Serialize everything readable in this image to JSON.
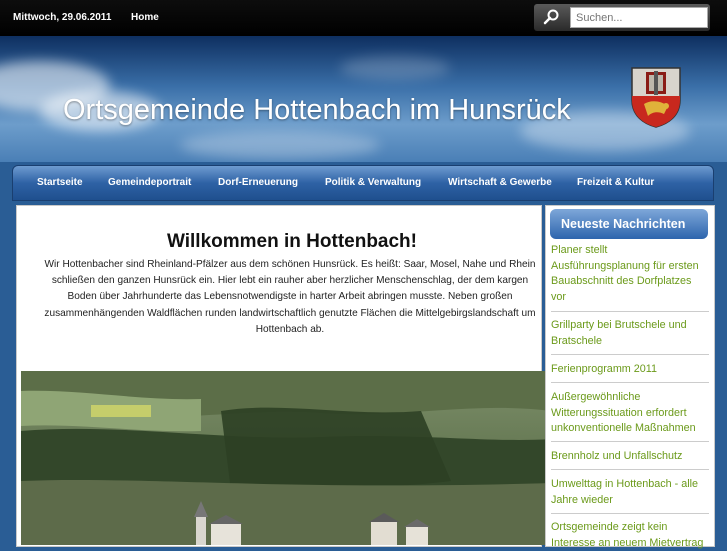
{
  "topbar": {
    "date": "Mittwoch, 29.06.2011",
    "home": "Home"
  },
  "search": {
    "placeholder": "Suchen..."
  },
  "header": {
    "title": "Ortsgemeinde Hottenbach im Hunsrück"
  },
  "nav": {
    "items": [
      {
        "label": "Startseite"
      },
      {
        "label": "Gemeindeportrait"
      },
      {
        "label": "Dorf-Erneuerung"
      },
      {
        "label": "Politik & Verwaltung"
      },
      {
        "label": "Wirtschaft & Gewerbe"
      },
      {
        "label": "Freizeit & Kultur"
      }
    ]
  },
  "main": {
    "title": "Willkommen in Hottenbach!",
    "intro_lines": [
      "Wir Hottenbacher sind Rheinland-Pfälzer aus dem schönen Hunsrück. Es heißt: Saar, Mosel, Nahe und Rhein",
      "schließen den ganzen Hunsrück ein. Hier lebt ein rauher aber herzlicher Menschenschlag, der dem kargen",
      "Boden über Jahrhunderte das Lebensnotwendigste in harter Arbeit abringen musste. Neben großen",
      "zusammenhängenden Waldflächen runden landwirtschaftlich genutzte Flächen die Mittelgebirgslandschaft um",
      "Hottenbach ab."
    ]
  },
  "sidebar": {
    "title": "Neueste Nachrichten",
    "news": [
      {
        "lines": [
          "Planer stellt",
          "Ausführungsplanung für ersten",
          "Bauabschnitt des Dorfplatzes",
          "vor"
        ]
      },
      {
        "lines": [
          "Grillparty bei Brutschele und",
          "Bratschele"
        ]
      },
      {
        "lines": [
          "Ferienprogramm 2011"
        ]
      },
      {
        "lines": [
          "Außergewöhnliche",
          "Witterungssituation erfordert",
          "unkonventionelle Maßnahmen"
        ]
      },
      {
        "lines": [
          "Brennholz und Unfallschutz"
        ]
      },
      {
        "lines": [
          "Umwelttag in Hottenbach - alle",
          "Jahre wieder"
        ]
      },
      {
        "lines": [
          "Ortsgemeinde zeigt kein",
          "Interesse an neuem Mietvertrag"
        ]
      }
    ]
  },
  "colors": {
    "nav_bar": "#2e62a5",
    "news_link": "#6b9a1a",
    "header_sky": "#3a6fa8"
  }
}
